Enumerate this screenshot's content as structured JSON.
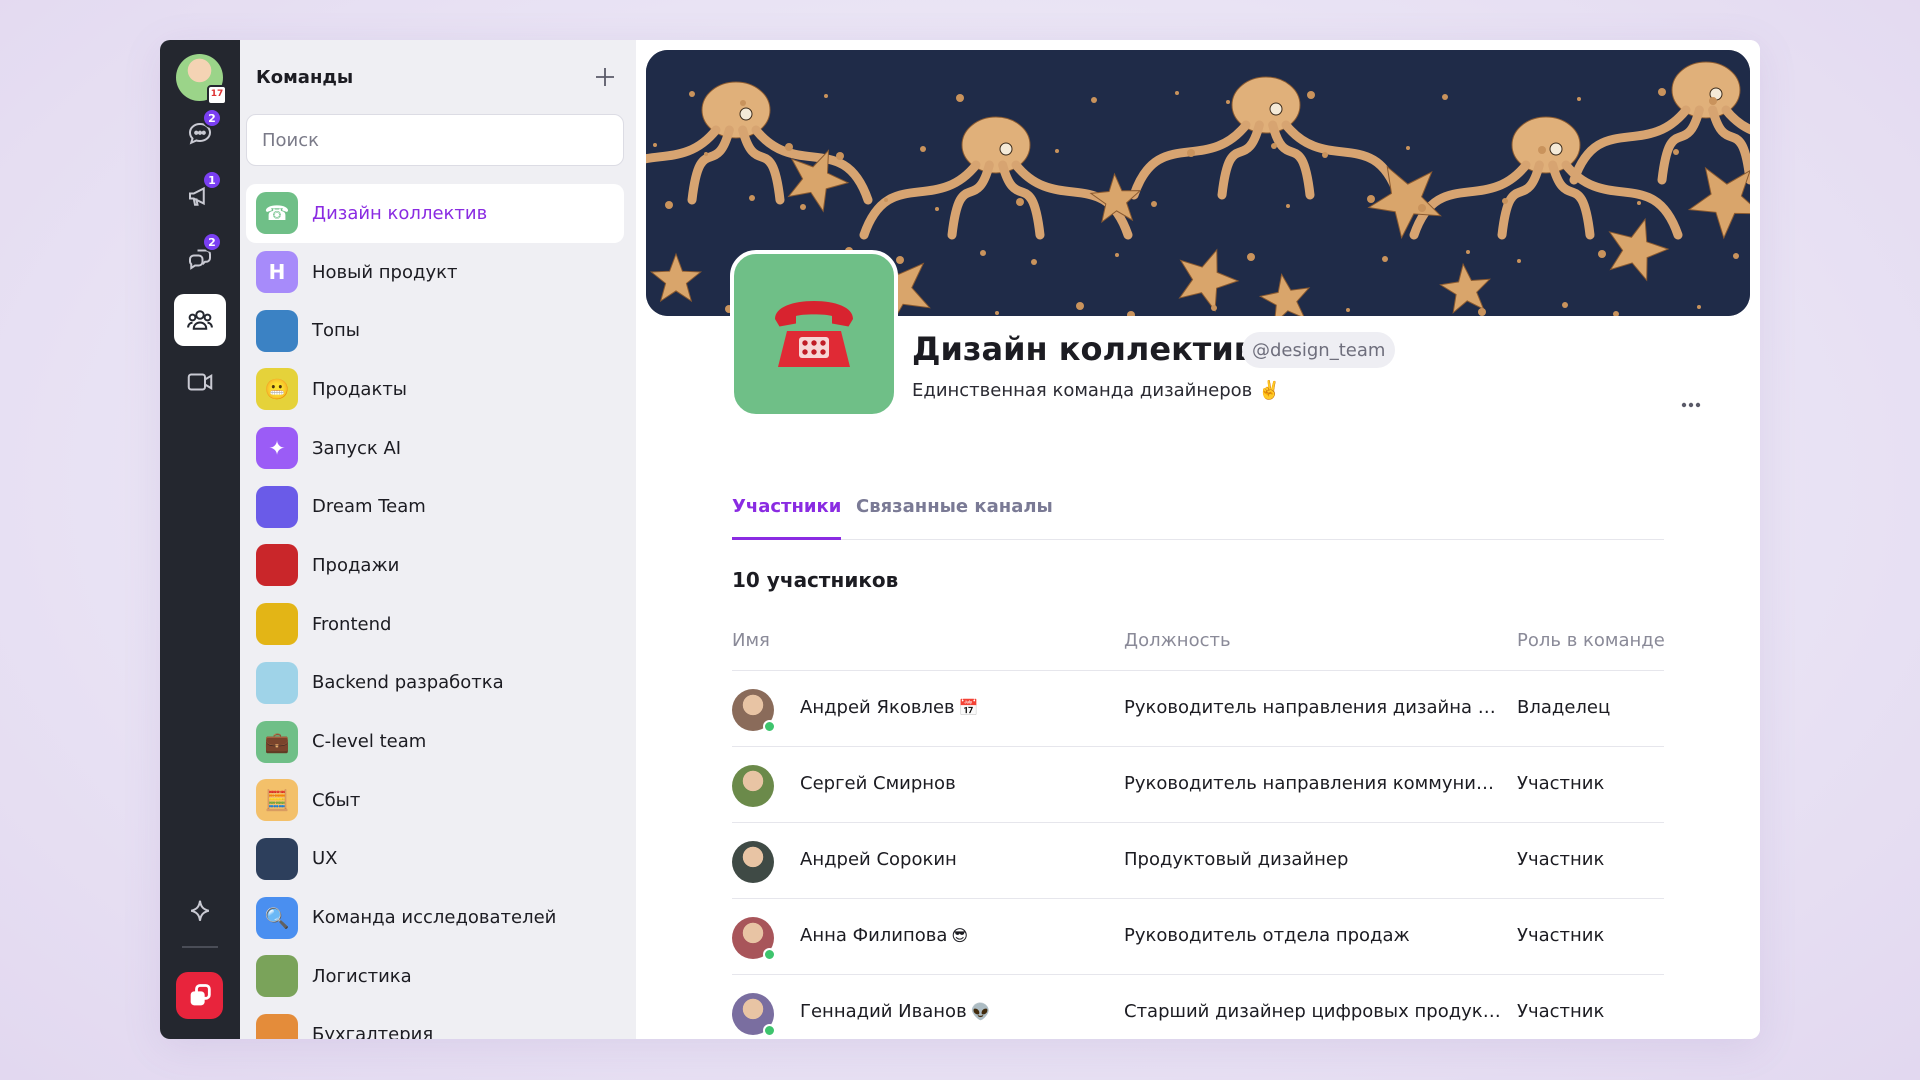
{
  "rail": {
    "avatar_badge": "17",
    "items": [
      {
        "name": "chats",
        "icon": "chat-bubble-icon",
        "badge": "2"
      },
      {
        "name": "channels",
        "icon": "megaphone-icon",
        "badge": "1"
      },
      {
        "name": "threads",
        "icon": "threads-icon",
        "badge": "2"
      },
      {
        "name": "teams",
        "icon": "team-people-icon",
        "badge": ""
      },
      {
        "name": "calls",
        "icon": "video-camera-icon",
        "badge": ""
      }
    ],
    "bottom": {
      "ai_icon": "sparkle-icon",
      "app_icon": "app-logo-icon"
    }
  },
  "teams_panel": {
    "title": "Команды",
    "search_placeholder": "Поиск",
    "items": [
      {
        "label": "Дизайн коллектив",
        "icon": "telephone-icon",
        "color": "#6fbf87",
        "glyph": "☎",
        "active": true
      },
      {
        "label": "Новый продукт",
        "icon": "letter-n-icon",
        "color": "#a78bfa",
        "glyph": "Н"
      },
      {
        "label": "Топы",
        "icon": "cat-photo-icon",
        "color": "#3b82c4",
        "glyph": ""
      },
      {
        "label": "Продакты",
        "icon": "grimace-emoji-icon",
        "color": "#e5d23a",
        "glyph": "😬"
      },
      {
        "label": "Запуск AI",
        "icon": "sparkle-icon",
        "color": "#9b5cf6",
        "glyph": "✦"
      },
      {
        "label": "Dream Team",
        "icon": "gradient-wave-icon",
        "color": "#6a5be8",
        "glyph": ""
      },
      {
        "label": "Продажи",
        "icon": "ant-photo-icon",
        "color": "#c9262a",
        "glyph": ""
      },
      {
        "label": "Frontend",
        "icon": "pug-photo-icon",
        "color": "#e3b516",
        "glyph": ""
      },
      {
        "label": "Backend разработка",
        "icon": "giraffe-photo-icon",
        "color": "#9fd3e8",
        "glyph": ""
      },
      {
        "label": "C-level team",
        "icon": "briefcase-icon",
        "color": "#6fbf87",
        "glyph": "💼"
      },
      {
        "label": "Сбыт",
        "icon": "abacus-icon",
        "color": "#f3c06a",
        "glyph": "🧮"
      },
      {
        "label": "UX",
        "icon": "bird-photo-icon",
        "color": "#2d3f5c",
        "glyph": ""
      },
      {
        "label": "Команда исследователей",
        "icon": "magnifier-icon",
        "color": "#4a8ff0",
        "glyph": "🔍"
      },
      {
        "label": "Логистика",
        "icon": "road-photo-icon",
        "color": "#7aa35a",
        "glyph": ""
      },
      {
        "label": "Бухгалтерия",
        "icon": "dog-photo-icon",
        "color": "#e48c3a",
        "glyph": ""
      }
    ]
  },
  "team": {
    "name": "Дизайн коллектив",
    "handle": "@design_team",
    "description": "Единственная команда дизайнеров ✌️",
    "avatar_icon": "telephone-icon",
    "avatar_color": "#6fbf87",
    "banner": "octopus-starfish-pattern"
  },
  "tabs": [
    {
      "label": "Участники",
      "active": true
    },
    {
      "label": "Связанные каналы",
      "active": false
    }
  ],
  "members": {
    "count_label": "10 участников",
    "columns": {
      "name": "Имя",
      "title": "Должность",
      "role": "Роль в команде"
    },
    "rows": [
      {
        "name": "Андрей Яковлев",
        "emoji": "📅",
        "title": "Руководитель направления дизайна ци...",
        "role": "Владелец",
        "online": true,
        "avatar_color": "#8a6b5a"
      },
      {
        "name": "Сергей Смирнов",
        "emoji": "",
        "title": "Руководитель направления коммуника...",
        "role": "Участник",
        "online": false,
        "avatar_color": "#6b8a4a"
      },
      {
        "name": "Андрей Сорокин",
        "emoji": "",
        "title": "Продуктовый дизайнер",
        "role": "Участник",
        "online": false,
        "avatar_color": "#3f4a45"
      },
      {
        "name": "Анна Филипова",
        "emoji": "😎",
        "title": "Руководитель отдела продаж",
        "role": "Участник",
        "online": true,
        "avatar_color": "#a8555a"
      },
      {
        "name": "Геннадий Иванов",
        "emoji": "👽",
        "title": "Старший дизайнер цифровых продуктов",
        "role": "Участник",
        "online": true,
        "avatar_color": "#7a6ea0"
      }
    ]
  },
  "colors": {
    "accent": "#8a2be2",
    "rail_bg": "#24272f",
    "badge": "#7a3ff2",
    "online": "#3ec46d",
    "app_red": "#e8243c"
  }
}
